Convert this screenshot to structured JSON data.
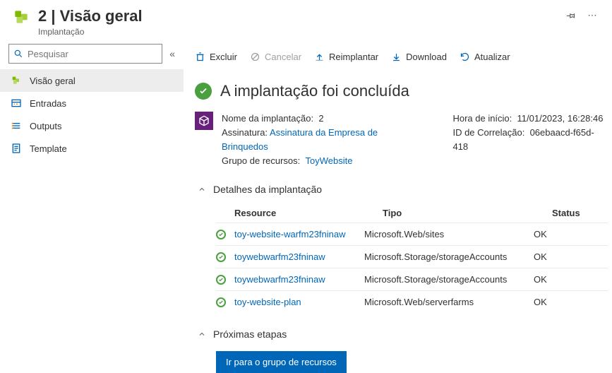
{
  "header": {
    "title": "2 | Visão geral",
    "subtitle": "Implantação"
  },
  "search": {
    "placeholder": "Pesquisar"
  },
  "sidebar": {
    "items": [
      {
        "label": "Visão geral",
        "icon": "cubes",
        "active": true
      },
      {
        "label": "Entradas",
        "icon": "inputs",
        "active": false
      },
      {
        "label": "Outputs",
        "icon": "outputs",
        "active": false
      },
      {
        "label": "Template",
        "icon": "template",
        "active": false
      }
    ]
  },
  "toolbar": {
    "delete": "Excluir",
    "cancel": "Cancelar",
    "redeploy": "Reimplantar",
    "download": "Download",
    "refresh": "Atualizar"
  },
  "status": {
    "title": "A implantação foi concluída"
  },
  "meta": {
    "deploy_name_label": "Nome da implantação:",
    "deploy_name_value": "2",
    "subscription_label": "Assinatura:",
    "subscription_link": "Assinatura da Empresa de Brinquedos",
    "rg_label": "Grupo de recursos:",
    "rg_link": "ToyWebsite",
    "start_label": "Hora de início:",
    "start_value": "11/01/2023, 16:28:46",
    "corr_label": "ID de Correlação:",
    "corr_value": "06ebaacd-f65d-418"
  },
  "sections": {
    "details_title": "Detalhes da implantação",
    "next_title": "Próximas etapas"
  },
  "columns": {
    "resource": "Resource",
    "type": "Tipo",
    "status": "Status"
  },
  "rows": [
    {
      "name": "toy-website-warfm23fninaw",
      "type": "Microsoft.Web/sites",
      "status": "OK"
    },
    {
      "name": "toywebwarfm23fninaw",
      "type": "Microsoft.Storage/storageAccounts",
      "status": "OK"
    },
    {
      "name": "toywebwarfm23fninaw",
      "type": "Microsoft.Storage/storageAccounts",
      "status": "OK"
    },
    {
      "name": "toy-website-plan",
      "type": "Microsoft.Web/serverfarms",
      "status": "OK"
    }
  ],
  "buttons": {
    "go_rg": "Ir para o grupo de recursos"
  }
}
